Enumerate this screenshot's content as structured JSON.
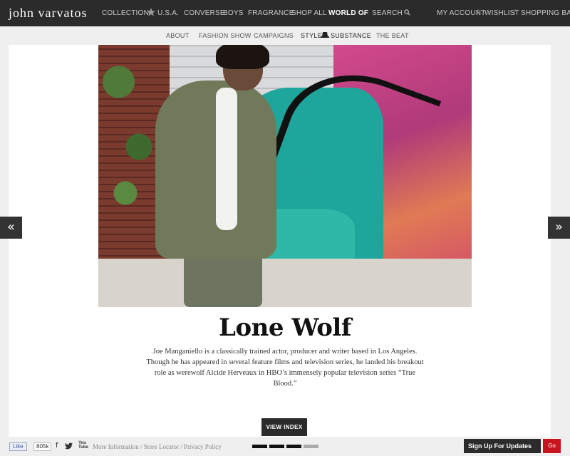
{
  "brand": {
    "logo": "john varvatos"
  },
  "nav": {
    "items": [
      {
        "label": "COLLECTION"
      },
      {
        "label": "U.S.A."
      },
      {
        "label": "CONVERSE"
      },
      {
        "label": "BOYS"
      },
      {
        "label": "FRAGRANCE"
      },
      {
        "label": "SHOP ALL"
      },
      {
        "label": "WORLD OF"
      },
      {
        "label": "SEARCH"
      }
    ],
    "active": "WORLD OF",
    "account": "MY ACCOUNT",
    "wishlist": "WISHLIST",
    "bag": "SHOPPING BAG",
    "separator": "/"
  },
  "subnav": {
    "items": [
      {
        "label": "ABOUT"
      },
      {
        "label": "FASHION SHOW"
      },
      {
        "label": "CAMPAIGNS"
      },
      {
        "label": "STYLE"
      },
      {
        "label": "SUBSTANCE"
      },
      {
        "label": "THE BEAT"
      }
    ]
  },
  "article": {
    "title": "Lone Wolf",
    "body": "Joe Manganiello is a classically trained actor, producer and writer based in Los Angeles. Though he has appeared in several feature films and television series, he landed his breakout role as werewolf Alcide Herveaux in HBO’s immensely popular television series “True Blood.”",
    "view_index": "VIEW INDEX"
  },
  "arrows": {
    "prev": "«",
    "next": "»"
  },
  "footer": {
    "fb_like": "Like",
    "fb_count": "805k",
    "links": "More Information / Store Locator / Privacy Policy",
    "youtube": "You Tube",
    "signup": "Sign Up For Updates",
    "go": "Go",
    "pager": {
      "total": 4,
      "active": 3
    }
  },
  "colors": {
    "bar": "#2b2b2b",
    "accent_red": "#c8141e",
    "panel": "#ffffff",
    "background": "#efefef"
  }
}
